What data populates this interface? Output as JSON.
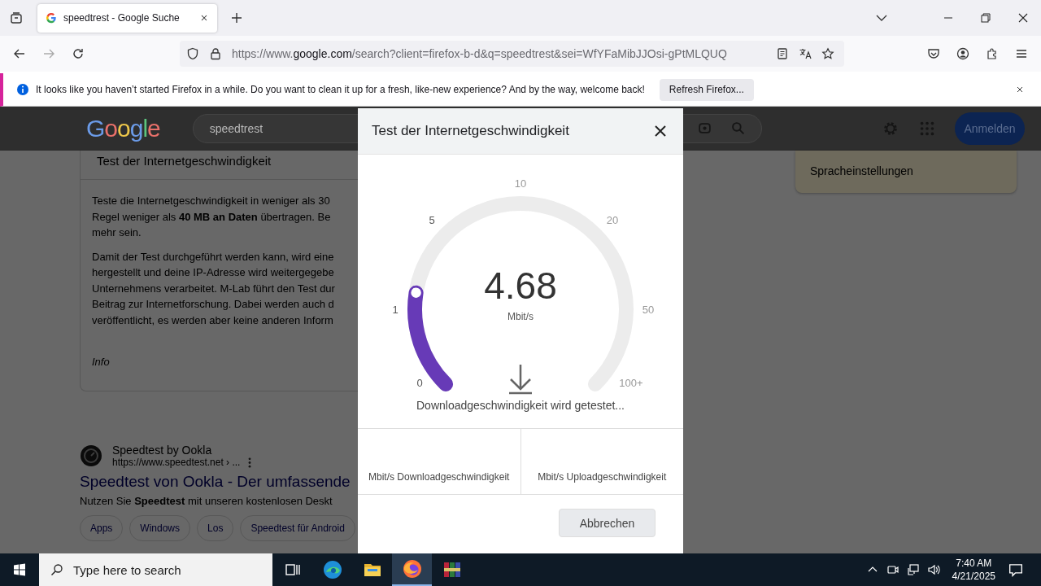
{
  "browser": {
    "tab": {
      "title": "speedtrest - Google Suche",
      "selected": true
    },
    "url": "https://www.**google.com**/search?client=firefox-b-d&q=speedtrest&sei=WfYFaMibJJOsi-gPtMLQUQ",
    "notification": {
      "message": "It looks like you haven’t started Firefox in a while. Do you want to clean it up for a fresh, like-new experience? And by the way, welcome back!",
      "button": "Refresh Firefox..."
    }
  },
  "page": {
    "logo": "Google",
    "search_query": "speedtrest",
    "sign_in": "Anmelden",
    "language_settings": "Spracheinstellungen",
    "card": {
      "title": "Test der Internetgeschwindigkeit",
      "paragraphs": [
        [
          "Teste die Internetgeschwindigkeit in weniger als 30",
          "Regel weniger als **40 MB an Daten** übertragen. Be",
          "mehr sein."
        ],
        [
          "Damit der Test durchgeführt werden kann, wird eine",
          "hergestellt und deine IP-Adresse wird weitergegebe",
          "Unternehmens verarbeitet. M-Lab führt den Test dur",
          "Beitrag zur Internetforschung. Dabei werden auch d",
          "veröffentlicht, es werden aber keine anderen Inform"
        ]
      ],
      "info": "Info"
    },
    "result": {
      "site": "Speedtest by Ookla",
      "url": "https://www.speedtest.net › ...",
      "title": "Speedtest von Ookla - Der umfassende",
      "snippet": "Nutzen Sie **Speedtest** mit unseren kostenlosen Deskt",
      "chips": [
        "Apps",
        "Windows",
        "Los",
        "Speedtest für Android"
      ]
    }
  },
  "dialog": {
    "title": "Test der Internetgeschwindigkeit",
    "gauge": {
      "ticks": [
        "0",
        "1",
        "5",
        "10",
        "20",
        "50",
        "100+"
      ],
      "level": 0.2,
      "reading": "4.68",
      "unit": "Mbit/s"
    },
    "status": "Downloadgeschwindigkeit wird getestet...",
    "results": [
      "Mbit/s Downloadgeschwindigkeit",
      "Mbit/s Uploadgeschwindigkeit"
    ],
    "cancel": "Abbrechen"
  },
  "taskbar": {
    "search_placeholder": "Type here to search",
    "apps": [
      {
        "kind": "taskview",
        "active": false
      },
      {
        "kind": "edge",
        "active": false
      },
      {
        "kind": "explorer",
        "active": false
      },
      {
        "kind": "firefox",
        "active": true
      },
      {
        "kind": "winrar",
        "active": false
      }
    ],
    "time": "7:40 AM",
    "date": "4/21/2025"
  }
}
